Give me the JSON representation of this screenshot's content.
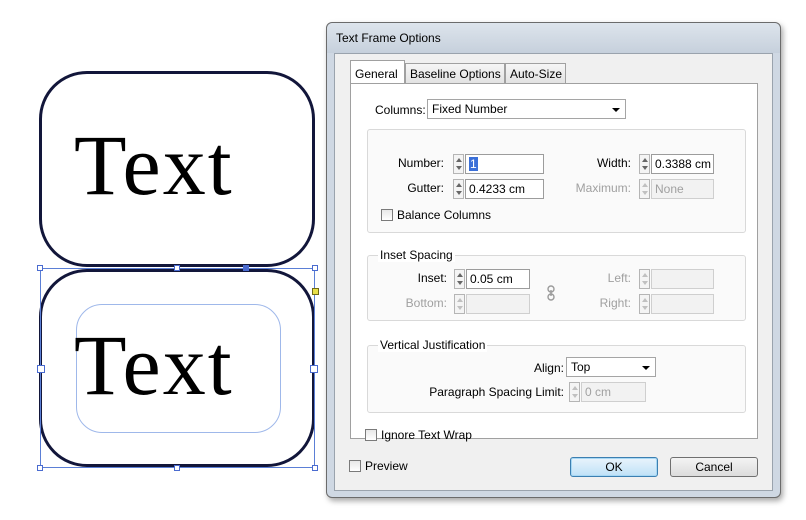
{
  "canvas": {
    "frame_top_text": "Text",
    "frame_bottom_text": "Text"
  },
  "dialog": {
    "title": "Text Frame Options",
    "tabs": [
      "General",
      "Baseline Options",
      "Auto-Size"
    ],
    "active_tab": "General",
    "columns": {
      "label": "Columns:",
      "value": "Fixed Number",
      "number_label": "Number:",
      "number_value": "1",
      "gutter_label": "Gutter:",
      "gutter_value": "0.4233 cm",
      "width_label": "Width:",
      "width_value": "0.3388 cm",
      "maximum_label": "Maximum:",
      "maximum_value": "None",
      "balance_label": "Balance Columns",
      "balance_checked": false
    },
    "inset": {
      "title": "Inset Spacing",
      "inset_label": "Inset:",
      "inset_value": "0.05 cm",
      "bottom_label": "Bottom:",
      "left_label": "Left:",
      "right_label": "Right:"
    },
    "vertical": {
      "title": "Vertical Justification",
      "align_label": "Align:",
      "align_value": "Top",
      "spacing_label": "Paragraph Spacing Limit:",
      "spacing_value": "0 cm"
    },
    "ignore_wrap_label": "Ignore Text Wrap",
    "ignore_wrap_checked": false,
    "preview_label": "Preview",
    "preview_checked": false,
    "ok_label": "OK",
    "cancel_label": "Cancel"
  },
  "colors": {
    "frame_stroke": "#12163a",
    "selection": "#4a6bd0",
    "default_button": "#3c7fb1"
  }
}
